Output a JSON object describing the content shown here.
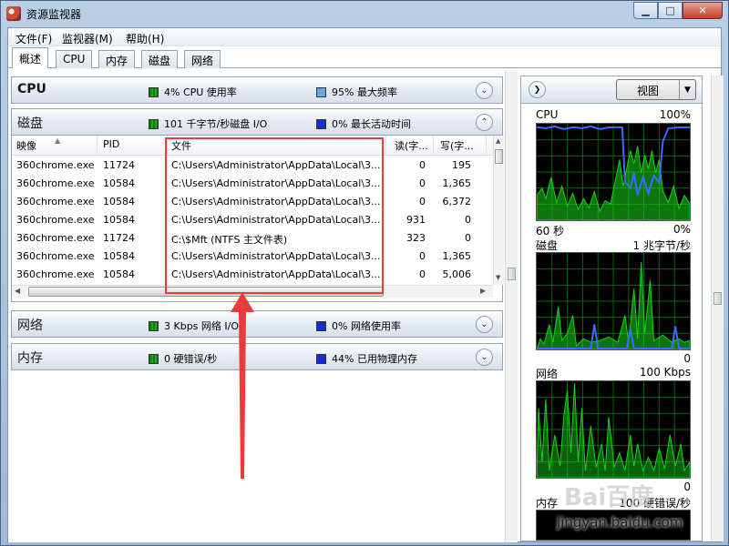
{
  "window": {
    "title": "资源监视器",
    "min_glyph": "▁",
    "max_glyph": "□",
    "close_glyph": "✕"
  },
  "menu": {
    "items": [
      "文件(F)",
      "监视器(M)",
      "帮助(H)"
    ]
  },
  "tabs": [
    "概述",
    "CPU",
    "内存",
    "磁盘",
    "网络"
  ],
  "sections": {
    "cpu": {
      "title": "CPU",
      "legend1": "4% CPU 使用率",
      "legend2": "95% 最大频率",
      "colors": [
        "#1ea81e",
        "#6ba6ea"
      ]
    },
    "disk": {
      "title": "磁盘",
      "legend1": "101 千字节/秒磁盘 I/O",
      "legend2": "0% 最长活动时间",
      "colors": [
        "#1ea81e",
        "#1330c8"
      ]
    },
    "net": {
      "title": "网络",
      "legend1": "3 Kbps 网络 I/O",
      "legend2": "0% 网络使用率",
      "colors": [
        "#1ea81e",
        "#1330c8"
      ]
    },
    "memory": {
      "title": "内存",
      "legend1": "0 硬错误/秒",
      "legend2": "44% 已用物理内存",
      "colors": [
        "#1ea81e",
        "#1330c8"
      ]
    }
  },
  "disk_table": {
    "headers": [
      "映像",
      "PID",
      "文件",
      "读(字...",
      "写(字..."
    ],
    "rows": [
      {
        "image": "360chrome.exe",
        "pid": "11724",
        "file": "C:\\Users\\Administrator\\AppData\\Local\\3...",
        "read": "0",
        "write": "195"
      },
      {
        "image": "360chrome.exe",
        "pid": "10584",
        "file": "C:\\Users\\Administrator\\AppData\\Local\\3...",
        "read": "0",
        "write": "1,365"
      },
      {
        "image": "360chrome.exe",
        "pid": "10584",
        "file": "C:\\Users\\Administrator\\AppData\\Local\\3...",
        "read": "0",
        "write": "6,372"
      },
      {
        "image": "360chrome.exe",
        "pid": "10584",
        "file": "C:\\Users\\Administrator\\AppData\\Local\\3...",
        "read": "931",
        "write": "0"
      },
      {
        "image": "360chrome.exe",
        "pid": "11724",
        "file": "C:\\$Mft (NTFS 主文件表)",
        "read": "323",
        "write": "0"
      },
      {
        "image": "360chrome.exe",
        "pid": "10584",
        "file": "C:\\Users\\Administrator\\AppData\\Local\\3...",
        "read": "0",
        "write": "1,365"
      },
      {
        "image": "360chrome.exe",
        "pid": "10584",
        "file": "C:\\Users\\Administrator\\AppData\\Local\\3...",
        "read": "0",
        "write": "5,006"
      }
    ]
  },
  "right_pane": {
    "view_label": "视图",
    "graphs": [
      {
        "name": "CPU",
        "top_right": "100%",
        "bottom_left": "60 秒",
        "bottom_right": "0%"
      },
      {
        "name": "磁盘",
        "top_right": "1 兆字节/秒",
        "bottom_left": "",
        "bottom_right": "0"
      },
      {
        "name": "网络",
        "top_right": "100 Kbps",
        "bottom_left": "",
        "bottom_right": "0"
      },
      {
        "name": "内存",
        "top_right": "100 硬错误/秒"
      }
    ]
  },
  "watermark": {
    "logo": "Bai百度",
    "url": "jingyan.baidu.com"
  },
  "colors": {
    "annotation": "#e83c3c",
    "graph_green": "#19d419",
    "graph_blue": "#3b6dff",
    "grid": "#0a6a0a"
  }
}
